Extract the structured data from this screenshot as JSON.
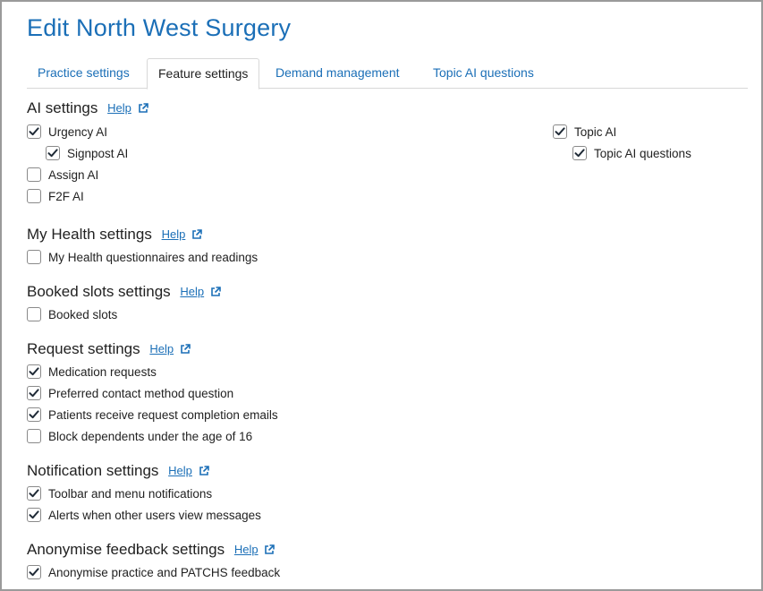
{
  "page": {
    "title": "Edit North West Surgery"
  },
  "tabs": [
    {
      "label": "Practice settings"
    },
    {
      "label": "Feature settings"
    },
    {
      "label": "Demand management"
    },
    {
      "label": "Topic AI questions"
    }
  ],
  "help_label": "Help",
  "sections": {
    "ai": {
      "heading": "AI settings",
      "items": [
        {
          "label": "Urgency AI",
          "checked": true
        },
        {
          "label": "Signpost AI",
          "checked": true
        },
        {
          "label": "Assign AI",
          "checked": false
        },
        {
          "label": "F2F AI",
          "checked": false
        },
        {
          "label": "Topic AI",
          "checked": true
        },
        {
          "label": "Topic AI questions",
          "checked": true
        }
      ]
    },
    "my_health": {
      "heading": "My Health settings",
      "items": [
        {
          "label": "My Health questionnaires and readings",
          "checked": false
        }
      ]
    },
    "booked_slots": {
      "heading": "Booked slots settings",
      "items": [
        {
          "label": "Booked slots",
          "checked": false
        }
      ]
    },
    "request": {
      "heading": "Request settings",
      "items": [
        {
          "label": "Medication requests",
          "checked": true
        },
        {
          "label": "Preferred contact method question",
          "checked": true
        },
        {
          "label": "Patients receive request completion emails",
          "checked": true
        },
        {
          "label": "Block dependents under the age of 16",
          "checked": false
        }
      ]
    },
    "notification": {
      "heading": "Notification settings",
      "items": [
        {
          "label": "Toolbar and menu notifications",
          "checked": true
        },
        {
          "label": "Alerts when other users view messages",
          "checked": true
        }
      ]
    },
    "anonymise": {
      "heading": "Anonymise feedback settings",
      "items": [
        {
          "label": "Anonymise practice and PATCHS feedback",
          "checked": true
        }
      ]
    }
  },
  "colors": {
    "accent": "#1b6fb7",
    "text": "#222222",
    "border": "#d8d8d8"
  }
}
